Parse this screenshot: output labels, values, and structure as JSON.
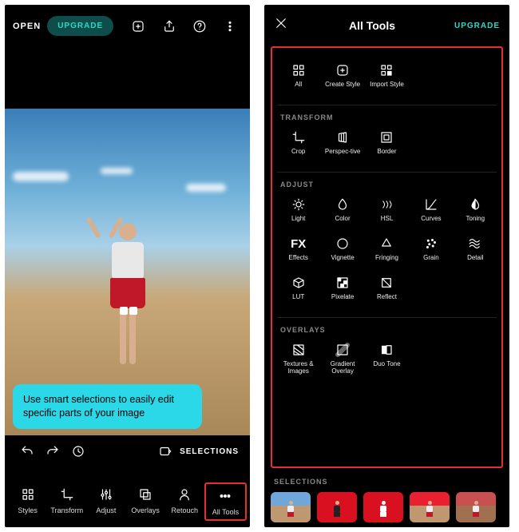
{
  "left": {
    "open_label": "OPEN",
    "upgrade_label": "UPGRADE",
    "tip_text": "Use smart selections to easily edit specific parts of your image",
    "selections_label": "SELECTIONS",
    "tools": [
      {
        "label": "Styles"
      },
      {
        "label": "Transform"
      },
      {
        "label": "Adjust"
      },
      {
        "label": "Overlays"
      },
      {
        "label": "Retouch"
      },
      {
        "label": "All Tools"
      }
    ]
  },
  "right": {
    "title": "All Tools",
    "upgrade_label": "UPGRADE",
    "sections": {
      "styles": {
        "items": [
          {
            "label": "All"
          },
          {
            "label": "Create Style"
          },
          {
            "label": "Import Style"
          }
        ]
      },
      "transform": {
        "header": "TRANSFORM",
        "items": [
          {
            "label": "Crop"
          },
          {
            "label": "Perspec-tive"
          },
          {
            "label": "Border"
          }
        ]
      },
      "adjust": {
        "header": "ADJUST",
        "items": [
          {
            "label": "Light"
          },
          {
            "label": "Color"
          },
          {
            "label": "HSL"
          },
          {
            "label": "Curves"
          },
          {
            "label": "Toning"
          },
          {
            "label": "Effects"
          },
          {
            "label": "Vignette"
          },
          {
            "label": "Fringing"
          },
          {
            "label": "Grain"
          },
          {
            "label": "Detail"
          },
          {
            "label": "LUT"
          },
          {
            "label": "Pixelate"
          },
          {
            "label": "Reflect"
          }
        ]
      },
      "overlays": {
        "header": "OVERLAYS",
        "items": [
          {
            "label": "Textures & Images"
          },
          {
            "label": "Gradient Overlay"
          },
          {
            "label": "Duo Tone"
          }
        ]
      }
    },
    "selections_header": "SELECTIONS"
  }
}
